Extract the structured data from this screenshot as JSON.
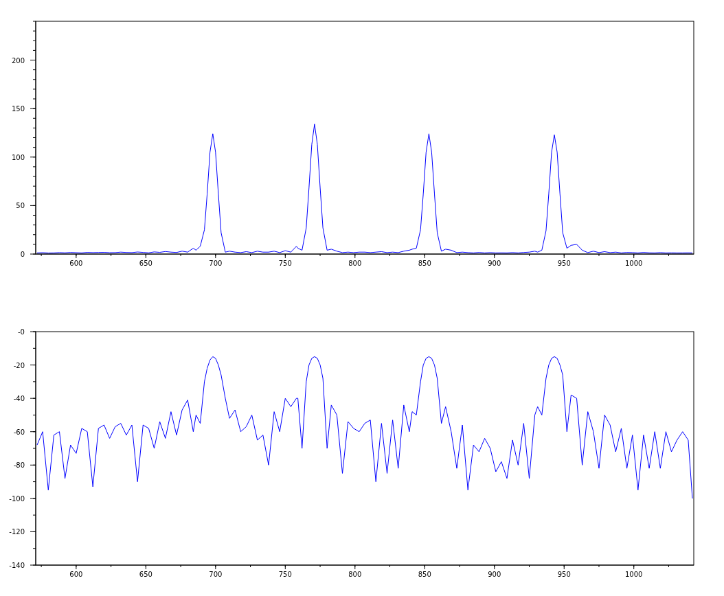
{
  "plots": [
    {
      "chart_data": {
        "type": "line",
        "xlim": [
          571,
          1043
        ],
        "ylim": [
          0,
          240
        ],
        "xticks": [
          600,
          650,
          700,
          750,
          800,
          850,
          900,
          950,
          1000
        ],
        "yticks": [
          0,
          50,
          100,
          150,
          200
        ],
        "x": [
          572,
          576,
          580,
          584,
          588,
          592,
          596,
          600,
          604,
          608,
          612,
          616,
          620,
          624,
          628,
          632,
          636,
          640,
          644,
          648,
          652,
          656,
          660,
          664,
          668,
          672,
          676,
          680,
          684,
          686,
          689,
          692,
          694,
          696,
          698,
          700,
          702,
          704,
          707,
          710,
          714,
          718,
          722,
          726,
          730,
          734,
          738,
          742,
          746,
          750,
          754,
          758,
          759,
          762,
          765,
          767,
          769,
          771,
          773,
          775,
          777,
          780,
          783,
          787,
          791,
          795,
          799,
          803,
          807,
          811,
          815,
          819,
          823,
          827,
          831,
          835,
          839,
          841,
          844,
          847,
          849,
          851,
          853,
          855,
          857,
          859,
          862,
          865,
          869,
          873,
          877,
          881,
          885,
          889,
          893,
          897,
          901,
          905,
          909,
          913,
          917,
          921,
          925,
          929,
          931,
          934,
          937,
          939,
          941,
          943,
          945,
          947,
          949,
          952,
          955,
          959,
          963,
          967,
          971,
          975,
          979,
          983,
          987,
          991,
          995,
          999,
          1003,
          1007,
          1011,
          1015,
          1019,
          1023,
          1027,
          1031,
          1035,
          1039,
          1042
        ],
        "series": [
          {
            "color": "#0000ff",
            "values": [
              1.2,
              1.4,
              1.1,
              1.2,
              1.5,
              1.3,
              1.6,
              1.4,
              1.2,
              1.7,
              1.5,
              1.6,
              1.8,
              1.4,
              1.5,
              2,
              1.6,
              1.5,
              2.1,
              1.7,
              1.3,
              2.2,
              1.8,
              2.6,
              2,
              1.6,
              3,
              2,
              6,
              4,
              8,
              25,
              62,
              105,
              124,
              105,
              62,
              22,
              2,
              3,
              2,
              1.5,
              2.5,
              1.5,
              3,
              2,
              2,
              3,
              1.5,
              3.5,
              2,
              8,
              6,
              4,
              27,
              68,
              113,
              134,
              113,
              68,
              27,
              4,
              5,
              3,
              1.5,
              2,
              1.5,
              2,
              2,
              1.5,
              2,
              2.5,
              1.5,
              2,
              1.5,
              3,
              4,
              5,
              6,
              25,
              62,
              105,
              124,
              105,
              62,
              22,
              3,
              5,
              4,
              1.5,
              2,
              1.5,
              1.2,
              1.6,
              1.2,
              1.5,
              1.2,
              1.3,
              1.2,
              1.5,
              1.2,
              1.6,
              2,
              3,
              2,
              4,
              24,
              62,
              105,
              123,
              105,
              62,
              22,
              6,
              9,
              10,
              4,
              1.5,
              3,
              1.5,
              2.5,
              1.5,
              2,
              1.2,
              1.6,
              1.5,
              1.2,
              1.6,
              1.3,
              1.2,
              1.5,
              1.2,
              1.3,
              1.2,
              1.2,
              1.3,
              1.2
            ]
          }
        ]
      }
    },
    {
      "chart_data": {
        "type": "line",
        "xlim": [
          571,
          1043
        ],
        "ylim": [
          -140,
          0
        ],
        "xticks": [
          600,
          650,
          700,
          750,
          800,
          850,
          900,
          950,
          1000
        ],
        "yticks": [
          {
            "value": 0,
            "label": "-0"
          },
          -20,
          -40,
          -60,
          -80,
          -100,
          -120,
          -140
        ],
        "x": [
          572,
          576,
          580,
          584,
          588,
          592,
          596,
          600,
          604,
          608,
          612,
          616,
          620,
          624,
          628,
          632,
          636,
          640,
          644,
          648,
          652,
          656,
          660,
          664,
          668,
          672,
          676,
          680,
          684,
          686,
          689,
          692,
          694,
          696,
          698,
          700,
          702,
          704,
          707,
          710,
          714,
          718,
          722,
          726,
          730,
          734,
          738,
          742,
          746,
          750,
          754,
          758,
          759,
          762,
          765,
          767,
          769,
          771,
          773,
          775,
          777,
          780,
          783,
          787,
          791,
          795,
          799,
          803,
          807,
          811,
          815,
          819,
          823,
          827,
          831,
          835,
          839,
          841,
          844,
          847,
          849,
          851,
          853,
          855,
          857,
          859,
          862,
          865,
          869,
          873,
          877,
          881,
          885,
          889,
          893,
          897,
          901,
          905,
          909,
          913,
          917,
          921,
          925,
          929,
          931,
          934,
          937,
          939,
          941,
          943,
          945,
          947,
          949,
          952,
          955,
          959,
          963,
          967,
          971,
          975,
          979,
          983,
          987,
          991,
          995,
          999,
          1003,
          1007,
          1011,
          1015,
          1019,
          1023,
          1027,
          1031,
          1035,
          1039,
          1042
        ],
        "series": [
          {
            "color": "#0000ff",
            "values": [
              -68,
              -60,
              -95,
              -62,
              -60,
              -88,
              -68,
              -73,
              -58,
              -60,
              -93,
              -58,
              -56,
              -64,
              -57,
              -55,
              -62,
              -56,
              -90,
              -56,
              -58,
              -70,
              -54,
              -64,
              -48,
              -62,
              -47,
              -41,
              -60,
              -50,
              -55,
              -30,
              -22,
              -17,
              -15,
              -16,
              -20,
              -26,
              -40,
              -52,
              -47,
              -60,
              -57,
              -50,
              -65,
              -62,
              -80,
              -48,
              -60,
              -40,
              -45,
              -40,
              -40,
              -70,
              -30,
              -20,
              -16,
              -15,
              -16,
              -20,
              -28,
              -70,
              -44,
              -50,
              -85,
              -54,
              -58,
              -60,
              -55,
              -53,
              -90,
              -55,
              -85,
              -53,
              -82,
              -44,
              -60,
              -48,
              -50,
              -30,
              -20,
              -16,
              -15,
              -16,
              -20,
              -28,
              -55,
              -45,
              -60,
              -82,
              -56,
              -95,
              -68,
              -72,
              -64,
              -70,
              -84,
              -78,
              -88,
              -65,
              -80,
              -55,
              -88,
              -50,
              -45,
              -50,
              -28,
              -20,
              -16,
              -15,
              -16,
              -20,
              -26,
              -60,
              -38,
              -40,
              -80,
              -48,
              -60,
              -82,
              -50,
              -56,
              -72,
              -58,
              -82,
              -62,
              -95,
              -62,
              -82,
              -60,
              -82,
              -60,
              -72,
              -65,
              -60,
              -65,
              -100
            ]
          }
        ]
      }
    }
  ]
}
